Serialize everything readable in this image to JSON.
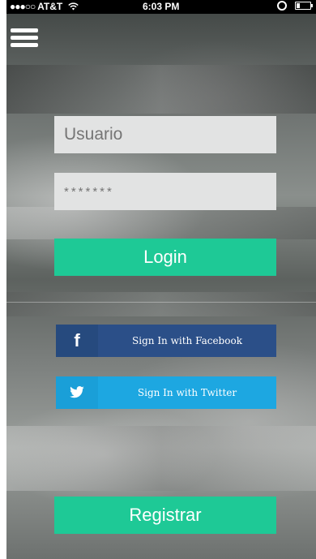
{
  "status_bar": {
    "signal": "●●●○○",
    "carrier": "AT&T",
    "time": "6:03 PM"
  },
  "login_form": {
    "username_placeholder": "Usuario",
    "password_placeholder": "*******",
    "login_label": "Login"
  },
  "social": {
    "facebook_label": "Sign In with Facebook",
    "facebook_glyph": "f",
    "twitter_label": "Sign In with Twitter"
  },
  "register_label": "Registrar",
  "colors": {
    "accent_green": "#1ec996",
    "facebook_blue": "#2b4f88",
    "twitter_blue": "#1da7e1",
    "field_bg": "#e2e3e3"
  },
  "icons": {
    "menu": "hamburger-menu-icon",
    "facebook": "facebook-icon",
    "twitter": "twitter-bird-icon",
    "alarm": "alarm-icon",
    "battery": "battery-icon",
    "wifi": "wifi-icon"
  }
}
